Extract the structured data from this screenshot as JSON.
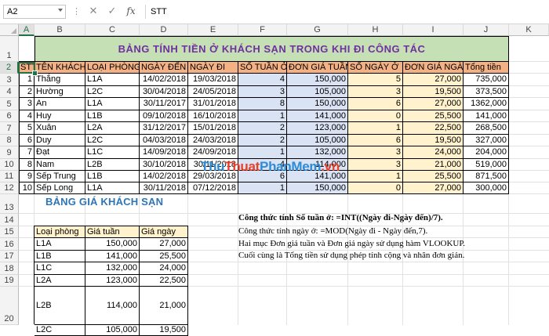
{
  "formula_bar": {
    "name_box": "A2",
    "cancel_icon": "✕",
    "enter_icon": "✓",
    "fx_label": "fx",
    "formula": "STT"
  },
  "columns": [
    "A",
    "B",
    "C",
    "D",
    "E",
    "F",
    "G",
    "H",
    "I",
    "J",
    "K"
  ],
  "rows": [
    "1",
    "2",
    "3",
    "4",
    "5",
    "6",
    "7",
    "8",
    "9",
    "10",
    "11",
    "12",
    "13",
    "14",
    "15",
    "16",
    "17",
    "18",
    "19",
    "20"
  ],
  "title": "BẢNG TÍNH TIỀN Ở KHÁCH SẠN TRONG KHI ĐI CÔNG TÁC",
  "main_table": {
    "headers": [
      "STT",
      "TÊN KHÁCH",
      "LOẠI PHÒNG",
      "NGÀY ĐẾN",
      "NGÀY ĐI",
      "SỐ TUẦN Ở",
      "ĐƠN GIÁ TUẦN",
      "SỐ NGÀY Ở",
      "ĐƠN GIÁ NGÀY",
      "Tổng tiền"
    ],
    "rows": [
      [
        "1",
        "Thắng",
        "L1A",
        "14/02/2018",
        "19/03/2018",
        "4",
        "150,000",
        "5",
        "27,000",
        "735,000"
      ],
      [
        "2",
        "Hường",
        "L2C",
        "30/04/2018",
        "24/05/2018",
        "3",
        "105,000",
        "3",
        "19,500",
        "373,500"
      ],
      [
        "3",
        "An",
        "L1A",
        "30/11/2017",
        "31/01/2018",
        "8",
        "150,000",
        "6",
        "27,000",
        "1362,000"
      ],
      [
        "4",
        "Huy",
        "L1B",
        "09/10/2018",
        "16/10/2018",
        "1",
        "141,000",
        "0",
        "25,500",
        "141,000"
      ],
      [
        "5",
        "Xuân",
        "L2A",
        "31/12/2017",
        "15/01/2018",
        "2",
        "123,000",
        "1",
        "22,500",
        "268,500"
      ],
      [
        "6",
        "Duy",
        "L2C",
        "04/03/2018",
        "24/03/2018",
        "2",
        "105,000",
        "6",
        "19,500",
        "327,000"
      ],
      [
        "7",
        "Đạt",
        "L1C",
        "14/09/2018",
        "24/09/2018",
        "1",
        "132,000",
        "3",
        "24,000",
        "204,000"
      ],
      [
        "8",
        "Nam",
        "L2B",
        "30/10/2018",
        "30/11/2018",
        "4",
        "114,000",
        "3",
        "21,000",
        "519,000"
      ],
      [
        "9",
        "Sếp Trung",
        "L1B",
        "14/02/2018",
        "29/03/2018",
        "6",
        "141,000",
        "1",
        "25,500",
        "871,500"
      ],
      [
        "10",
        "Sếp Long",
        "L1A",
        "30/11/2018",
        "07/12/2018",
        "1",
        "150,000",
        "0",
        "27,000",
        "300,000"
      ]
    ]
  },
  "price_table_title": "BẢNG GIÁ KHÁCH SẠN",
  "price_table": {
    "headers": [
      "Loại phòng",
      "Giá tuần",
      "Giá ngày"
    ],
    "rows": [
      [
        "L1A",
        "150,000",
        "27,000"
      ],
      [
        "L1B",
        "141,000",
        "25,500"
      ],
      [
        "L1C",
        "132,000",
        "24,000"
      ],
      [
        "L2A",
        "123,000",
        "22,500"
      ],
      [
        "L2B",
        "114,000",
        "21,000"
      ],
      [
        "L2C",
        "105,000",
        "19,500"
      ]
    ]
  },
  "notes": {
    "line1": "Công thức tính Số tuần ở: =INT((Ngày đi-Ngày đến)/7).",
    "line2": "Công thức tính ngày ở: =MOD(Ngày đi - Ngày đến,7).",
    "line3": "Hai mục Đơn giá tuần và Đơn giá ngày sử dụng hàm VLOOKUP.",
    "line4": "Cuối cùng là Tổng tiền sử dụng phép tính cộng và nhân đơn giản."
  },
  "watermark": {
    "part1": "Thu",
    "part2": "Thuat",
    "part3": "PhanMem",
    "part4": ".vn"
  },
  "colors": {
    "title_bg": "#c5e0b4",
    "title_text": "#7030a0",
    "header_bg": "#f4b183",
    "blue_col": "#dae3f3",
    "yellow_col": "#fff2cc",
    "price_title": "#2e75b6",
    "excel_green": "#217346"
  }
}
